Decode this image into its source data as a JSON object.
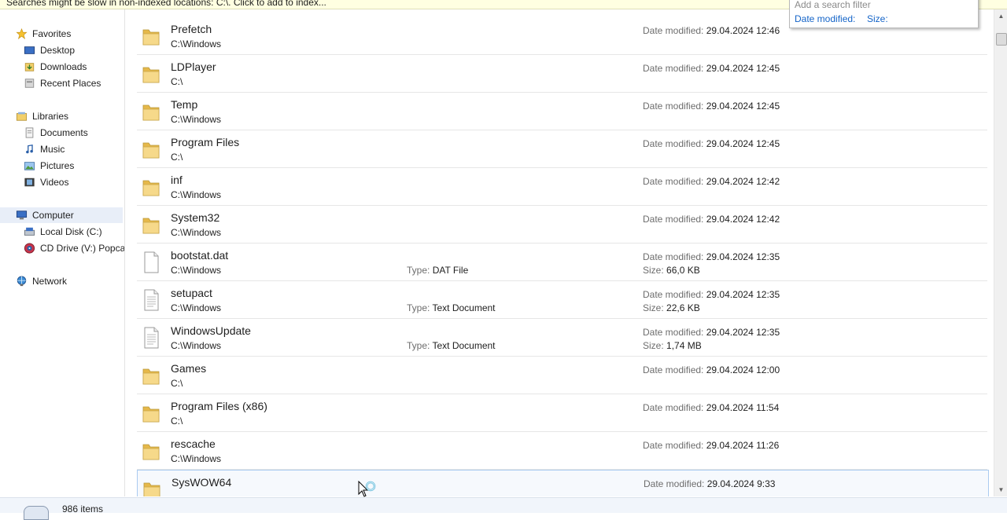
{
  "infobar": {
    "text": "Searches might be slow in non-indexed locations: C:\\. Click to add to index..."
  },
  "search_filter": {
    "placeholder": "Add a search filter",
    "filters": [
      "Date modified:",
      "Size:"
    ]
  },
  "nav": {
    "favorites": {
      "label": "Favorites",
      "items": [
        "Desktop",
        "Downloads",
        "Recent Places"
      ]
    },
    "libraries": {
      "label": "Libraries",
      "items": [
        "Documents",
        "Music",
        "Pictures",
        "Videos"
      ]
    },
    "computer": {
      "label": "Computer",
      "items": [
        "Local Disk (C:)",
        "CD Drive (V:) Popcap"
      ]
    },
    "network": {
      "label": "Network"
    }
  },
  "labels": {
    "date_modified": "Date modified:",
    "type": "Type:",
    "size": "Size:"
  },
  "results": [
    {
      "name": "Prefetch",
      "path": "C:\\Windows",
      "date": "29.04.2024 12:46",
      "icon": "folder-icon"
    },
    {
      "name": "LDPlayer",
      "path": "C:\\",
      "date": "29.04.2024 12:45",
      "icon": "folder-icon"
    },
    {
      "name": "Temp",
      "path": "C:\\Windows",
      "date": "29.04.2024 12:45",
      "icon": "folder-icon"
    },
    {
      "name": "Program Files",
      "path": "C:\\",
      "date": "29.04.2024 12:45",
      "icon": "folder-icon"
    },
    {
      "name": "inf",
      "path": "C:\\Windows",
      "date": "29.04.2024 12:42",
      "icon": "folder-icon"
    },
    {
      "name": "System32",
      "path": "C:\\Windows",
      "date": "29.04.2024 12:42",
      "icon": "folder-icon"
    },
    {
      "name": "bootstat.dat",
      "path": "C:\\Windows",
      "date": "29.04.2024 12:35",
      "type": "DAT File",
      "size": "66,0 KB",
      "icon": "file-icon"
    },
    {
      "name": "setupact",
      "path": "C:\\Windows",
      "date": "29.04.2024 12:35",
      "type": "Text Document",
      "size": "22,6 KB",
      "icon": "text-file-icon"
    },
    {
      "name": "WindowsUpdate",
      "path": "C:\\Windows",
      "date": "29.04.2024 12:35",
      "type": "Text Document",
      "size": "1,74 MB",
      "icon": "text-file-icon"
    },
    {
      "name": "Games",
      "path": "C:\\",
      "date": "29.04.2024 12:00",
      "icon": "folder-icon"
    },
    {
      "name": "Program Files (x86)",
      "path": "C:\\",
      "date": "29.04.2024 11:54",
      "icon": "folder-icon"
    },
    {
      "name": "rescache",
      "path": "C:\\Windows",
      "date": "29.04.2024 11:26",
      "icon": "folder-icon"
    },
    {
      "name": "SysWOW64",
      "path": "",
      "date": "29.04.2024 9:33",
      "icon": "folder-icon"
    }
  ],
  "status": {
    "items_count": "986 items"
  },
  "colors": {
    "accent": "#1464c8",
    "folder": "#f2cf6a",
    "hover_border": "#aacbf0"
  }
}
